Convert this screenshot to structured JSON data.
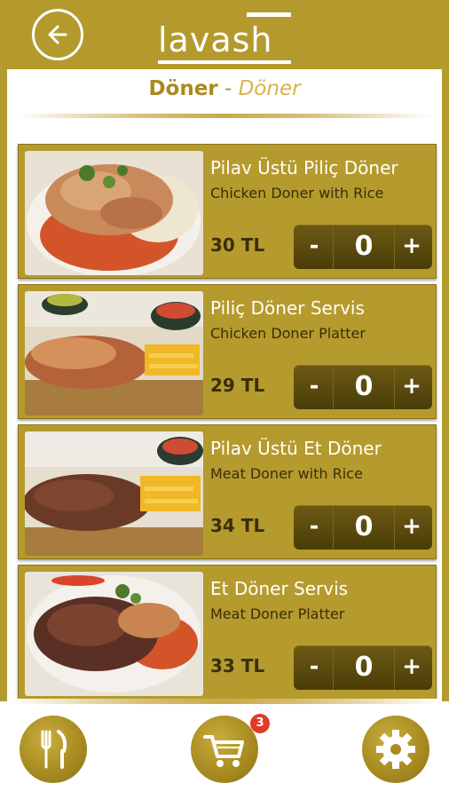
{
  "header": {
    "back_icon": "arrow-left-icon",
    "logo_text": "lavash"
  },
  "category": {
    "title": "Döner",
    "separator": " - ",
    "subtitle": "Döner"
  },
  "items": [
    {
      "name": "Pilav Üstü Piliç Döner",
      "description": "Chicken Doner with Rice",
      "price": "30 TL",
      "quantity": "0",
      "minus": "-",
      "plus": "+"
    },
    {
      "name": "Piliç Döner Servis",
      "description": "Chicken Doner Platter",
      "price": "29 TL",
      "quantity": "0",
      "minus": "-",
      "plus": "+"
    },
    {
      "name": "Pilav Üstü Et Döner",
      "description": "Meat Doner with Rice",
      "price": "34 TL",
      "quantity": "0",
      "minus": "-",
      "plus": "+"
    },
    {
      "name": "Et Döner Servis",
      "description": "Meat Doner Platter",
      "price": "33 TL",
      "quantity": "0",
      "minus": "-",
      "plus": "+"
    }
  ],
  "footer": {
    "menu_icon": "fork-knife-icon",
    "cart_icon": "cart-icon",
    "cart_count": "3",
    "settings_icon": "gear-icon"
  },
  "colors": {
    "brand_gold": "#b49a2d",
    "stepper_dark": "#4a3c08",
    "badge_red": "#e23a2a"
  }
}
